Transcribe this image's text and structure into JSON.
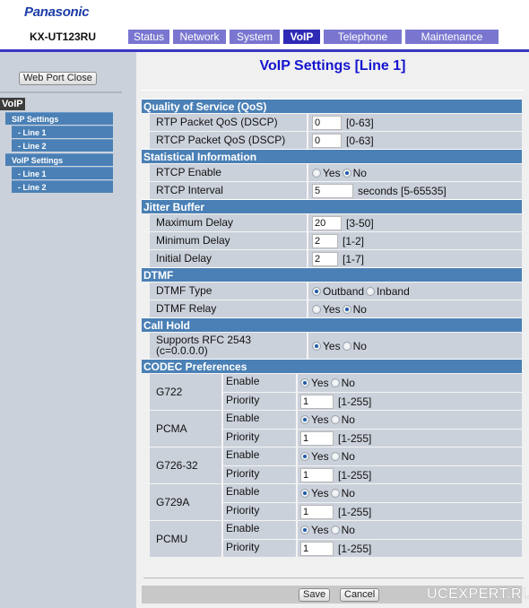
{
  "header": {
    "brand": "Panasonic",
    "model": "KX-UT123RU",
    "tabs": [
      {
        "label": "Status",
        "active": false
      },
      {
        "label": "Network",
        "active": false
      },
      {
        "label": "System",
        "active": false
      },
      {
        "label": "VoIP",
        "active": true
      },
      {
        "label": "Telephone",
        "active": false
      },
      {
        "label": "Maintenance",
        "active": false
      }
    ]
  },
  "sidebar": {
    "web_port_close": "Web Port Close",
    "section_title": "VoIP",
    "items": [
      {
        "label": "SIP Settings",
        "level": 0
      },
      {
        "label": "- Line 1",
        "level": 1
      },
      {
        "label": "- Line 2",
        "level": 1
      },
      {
        "label": "VoIP Settings",
        "level": 0
      },
      {
        "label": "- Line 1",
        "level": 1
      },
      {
        "label": "- Line 2",
        "level": 1
      }
    ]
  },
  "main": {
    "title": "VoIP Settings [Line 1]",
    "qos": {
      "header": "Quality of Service (QoS)",
      "rtp_label": "RTP Packet QoS (DSCP)",
      "rtp_value": "0",
      "rtp_hint": "[0-63]",
      "rtcp_label": "RTCP Packet QoS (DSCP)",
      "rtcp_value": "0",
      "rtcp_hint": "[0-63]"
    },
    "stats": {
      "header": "Statistical Information",
      "rtcp_enable_label": "RTCP Enable",
      "rtcp_enable_value": "No",
      "rtcp_interval_label": "RTCP Interval",
      "rtcp_interval_value": "5",
      "rtcp_interval_hint": "seconds [5-65535]"
    },
    "jitter": {
      "header": "Jitter Buffer",
      "max_label": "Maximum Delay",
      "max_value": "20",
      "max_hint": "[3-50]",
      "min_label": "Minimum Delay",
      "min_value": "2",
      "min_hint": "[1-2]",
      "init_label": "Initial Delay",
      "init_value": "2",
      "init_hint": "[1-7]"
    },
    "dtmf": {
      "header": "DTMF",
      "type_label": "DTMF Type",
      "type_options": [
        "Outband",
        "Inband"
      ],
      "type_value": "Outband",
      "relay_label": "DTMF Relay",
      "relay_value": "No"
    },
    "call_hold": {
      "header": "Call Hold",
      "rfc_label_line1": "Supports RFC 2543",
      "rfc_label_line2": "(c=0.0.0.0)",
      "rfc_value": "Yes"
    },
    "codec": {
      "header": "CODEC Preferences",
      "enable_label": "Enable",
      "priority_label": "Priority",
      "priority_hint": "[1-255]",
      "items": [
        {
          "name": "G722",
          "enable": "Yes",
          "priority": "1"
        },
        {
          "name": "PCMA",
          "enable": "Yes",
          "priority": "1"
        },
        {
          "name": "G726-32",
          "enable": "Yes",
          "priority": "1"
        },
        {
          "name": "G729A",
          "enable": "Yes",
          "priority": "1"
        },
        {
          "name": "PCMU",
          "enable": "Yes",
          "priority": "1"
        }
      ]
    },
    "yes_label": "Yes",
    "no_label": "No",
    "save_label": "Save",
    "cancel_label": "Cancel",
    "watermark": "UCEXPERT.RU"
  }
}
